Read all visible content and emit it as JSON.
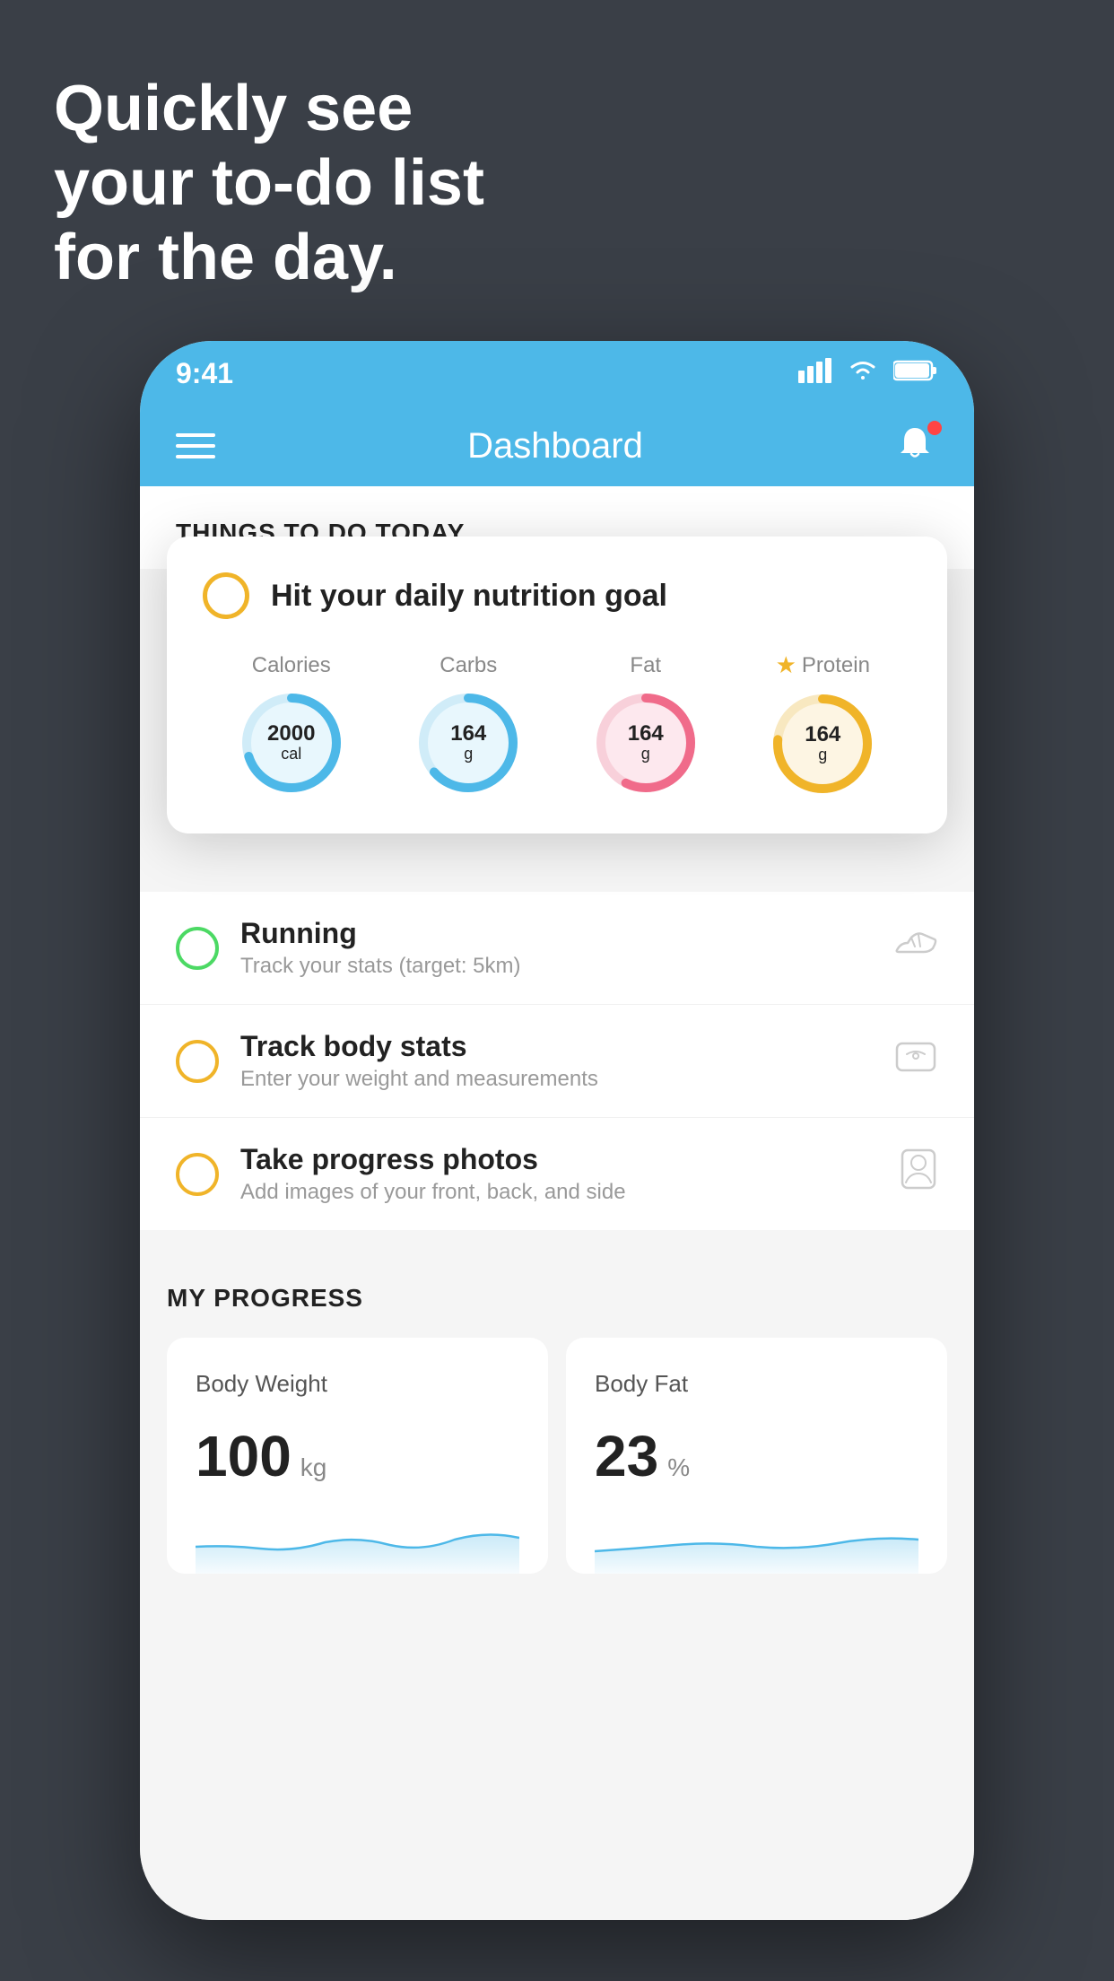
{
  "background": {
    "color": "#3a3f47"
  },
  "headline": {
    "line1": "Quickly see",
    "line2": "your to-do list",
    "line3": "for the day."
  },
  "phone": {
    "status_bar": {
      "time": "9:41",
      "signal_icon": "▋▋▋▋",
      "wifi_icon": "wifi",
      "battery_icon": "battery"
    },
    "nav": {
      "title": "Dashboard",
      "menu_icon": "hamburger",
      "bell_icon": "bell"
    },
    "section_header": "THINGS TO DO TODAY",
    "nutrition_card": {
      "title": "Hit your daily nutrition goal",
      "stats": [
        {
          "label": "Calories",
          "value": "2000",
          "unit": "cal",
          "color": "#4db8e8",
          "bg": "#e8f7fd",
          "starred": false
        },
        {
          "label": "Carbs",
          "value": "164",
          "unit": "g",
          "color": "#4db8e8",
          "bg": "#e8f7fd",
          "starred": false
        },
        {
          "label": "Fat",
          "value": "164",
          "unit": "g",
          "color": "#f06b8a",
          "bg": "#fde8ee",
          "starred": false
        },
        {
          "label": "Protein",
          "value": "164",
          "unit": "g",
          "color": "#f0b429",
          "bg": "#fdf5e3",
          "starred": true
        }
      ]
    },
    "todo_items": [
      {
        "name": "Running",
        "desc": "Track your stats (target: 5km)",
        "circle_color": "green",
        "icon": "shoe"
      },
      {
        "name": "Track body stats",
        "desc": "Enter your weight and measurements",
        "circle_color": "yellow",
        "icon": "scale"
      },
      {
        "name": "Take progress photos",
        "desc": "Add images of your front, back, and side",
        "circle_color": "yellow",
        "icon": "person"
      }
    ],
    "my_progress": {
      "section_title": "MY PROGRESS",
      "cards": [
        {
          "title": "Body Weight",
          "value": "100",
          "unit": "kg"
        },
        {
          "title": "Body Fat",
          "value": "23",
          "unit": "%"
        }
      ]
    }
  }
}
